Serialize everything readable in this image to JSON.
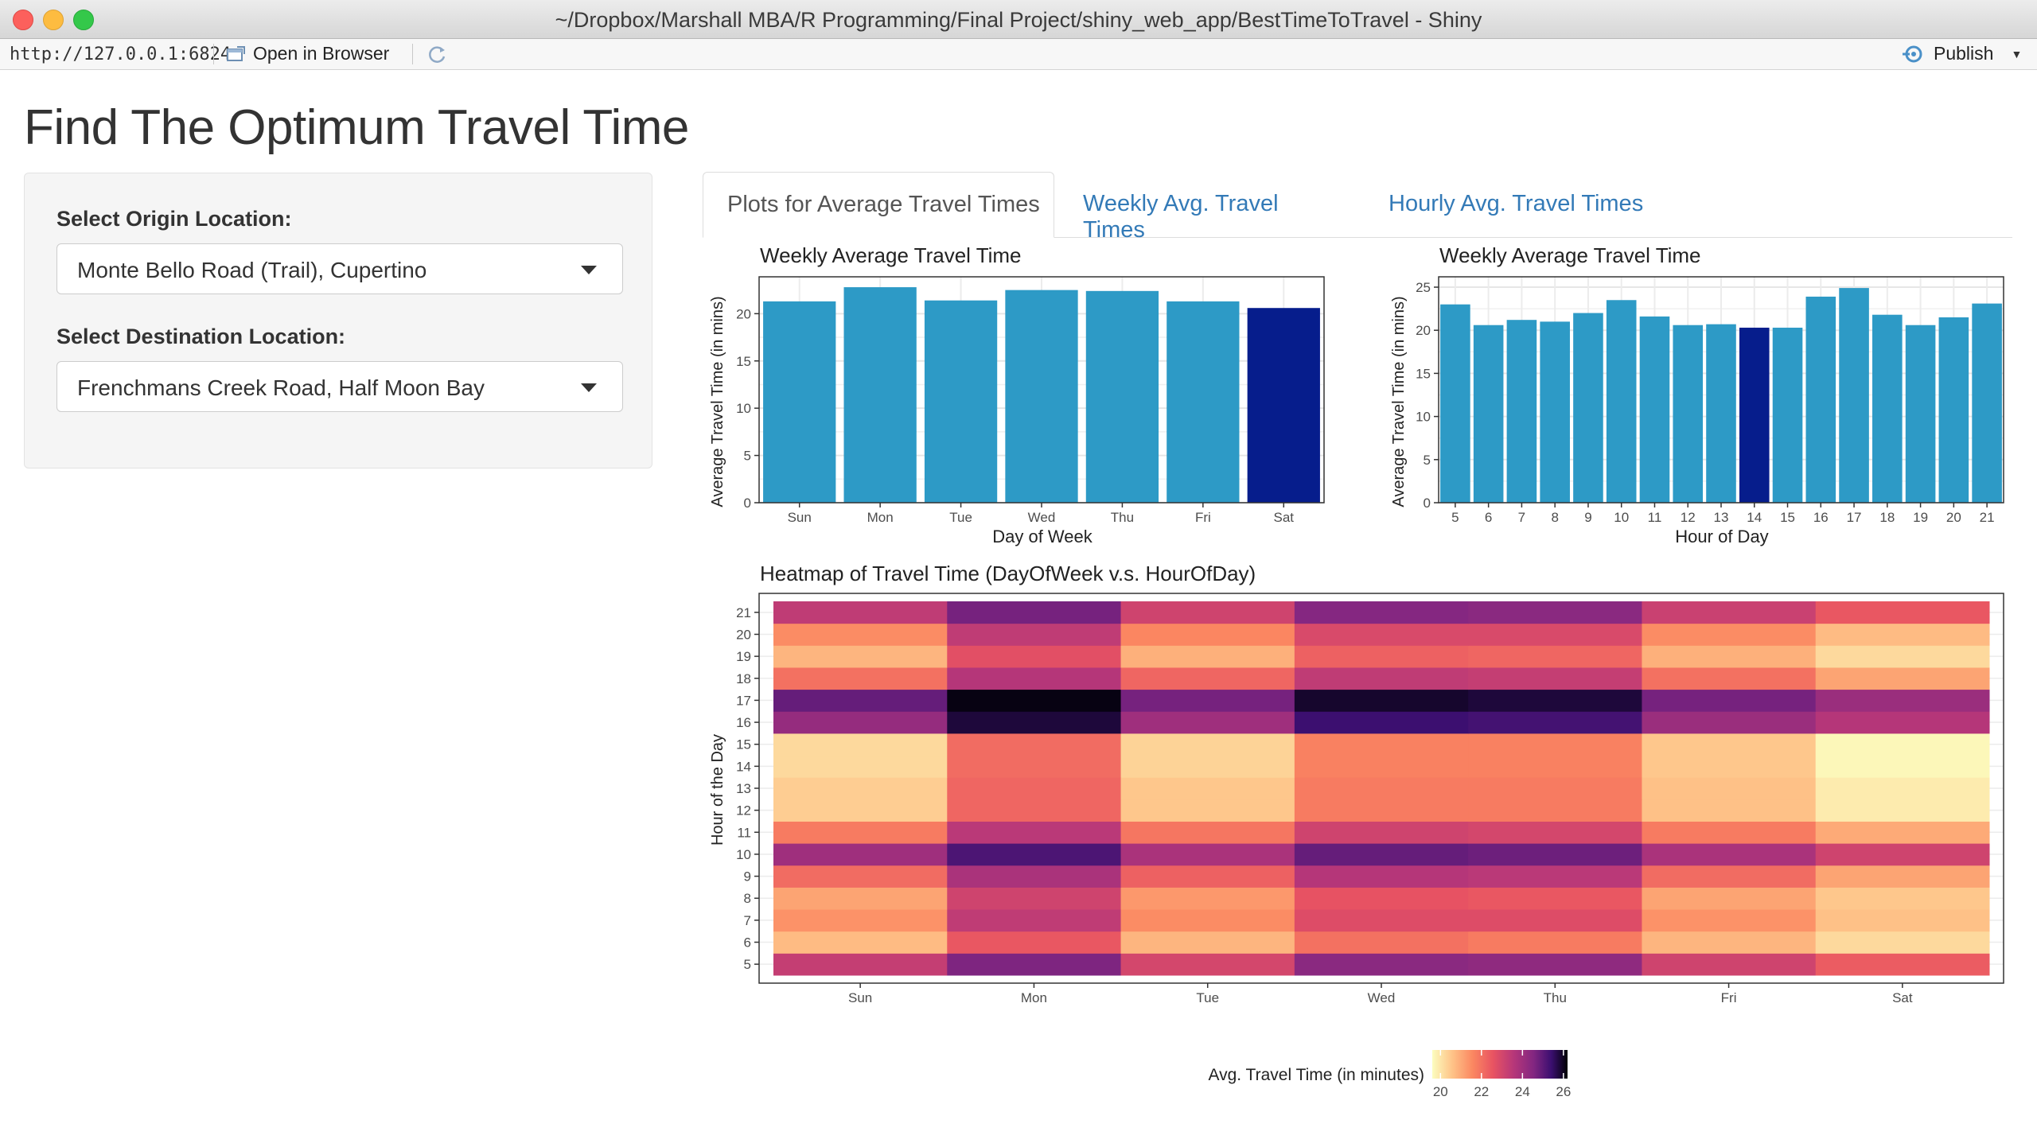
{
  "window": {
    "title": "~/Dropbox/Marshall MBA/R Programming/Final Project/shiny_web_app/BestTimeToTravel - Shiny"
  },
  "toolbar": {
    "url": "http://127.0.0.1:6824",
    "open_browser": "Open in Browser",
    "publish": "Publish"
  },
  "page": {
    "title": "Find The Optimum Travel Time"
  },
  "sidebar": {
    "origin_label": "Select Origin Location:",
    "origin_value": "Monte Bello Road (Trail), Cupertino",
    "destination_label": "Select Destination Location:",
    "destination_value": "Frenchmans Creek Road, Half Moon Bay"
  },
  "tabs": [
    {
      "label": "Plots for Average Travel Times",
      "active": true
    },
    {
      "label": "Weekly Avg. Travel Times",
      "active": false
    },
    {
      "label": "Hourly Avg. Travel Times",
      "active": false
    }
  ],
  "colors": {
    "bar": "#2d9ac6",
    "bar_min": "#061d8c",
    "link": "#337ab7"
  },
  "chart_data": [
    {
      "type": "bar",
      "title": "Weekly Average Travel Time",
      "xlabel": "Day of Week",
      "ylabel": "Average Travel Time (in mins)",
      "categories": [
        "Sun",
        "Mon",
        "Tue",
        "Wed",
        "Thu",
        "Fri",
        "Sat"
      ],
      "values": [
        21.3,
        22.8,
        21.4,
        22.5,
        22.4,
        21.3,
        20.6
      ],
      "highlight": "Sat",
      "ylim": [
        0,
        23.9
      ],
      "yticks": [
        0,
        5,
        10,
        15,
        20
      ]
    },
    {
      "type": "bar",
      "title": "Weekly Average Travel Time",
      "xlabel": "Hour of Day",
      "ylabel": "Average Travel Time (in mins)",
      "categories": [
        "5",
        "6",
        "7",
        "8",
        "9",
        "10",
        "11",
        "12",
        "13",
        "14",
        "15",
        "16",
        "17",
        "18",
        "19",
        "20",
        "21"
      ],
      "values": [
        23.0,
        20.6,
        21.2,
        21.0,
        22.0,
        23.5,
        21.6,
        20.6,
        20.7,
        20.3,
        20.3,
        23.9,
        24.9,
        21.8,
        20.6,
        21.5,
        23.1
      ],
      "highlight": "14",
      "ylim": [
        0,
        26.2
      ],
      "yticks": [
        0,
        5,
        10,
        15,
        20,
        25
      ]
    },
    {
      "type": "heatmap",
      "title": "Heatmap of Travel Time (DayOfWeek v.s. HourOfDay)",
      "xlabel": "",
      "ylabel": "Hour of the Day",
      "x": [
        "Sun",
        "Mon",
        "Tue",
        "Wed",
        "Thu",
        "Fri",
        "Sat"
      ],
      "y": [
        "5",
        "6",
        "7",
        "8",
        "9",
        "10",
        "11",
        "12",
        "13",
        "14",
        "15",
        "16",
        "17",
        "18",
        "19",
        "20",
        "21"
      ],
      "z": [
        [
          23.3,
          24.6,
          23.0,
          24.4,
          24.3,
          23.1,
          22.4
        ],
        [
          20.7,
          22.5,
          20.8,
          22.0,
          21.8,
          20.8,
          20.2
        ],
        [
          21.4,
          23.4,
          21.5,
          22.8,
          22.8,
          21.4,
          20.6
        ],
        [
          21.1,
          23.1,
          21.3,
          22.6,
          22.5,
          21.1,
          20.5
        ],
        [
          22.1,
          23.8,
          22.3,
          23.6,
          23.5,
          22.1,
          21.1
        ],
        [
          24.0,
          25.2,
          23.8,
          24.9,
          24.8,
          23.8,
          23.1
        ],
        [
          21.8,
          23.5,
          21.9,
          23.1,
          23.0,
          21.8,
          21.0
        ],
        [
          20.4,
          22.2,
          20.5,
          21.8,
          21.8,
          20.6,
          19.9
        ],
        [
          20.4,
          22.2,
          20.5,
          21.8,
          21.8,
          20.6,
          19.9
        ],
        [
          20.2,
          22.1,
          20.3,
          21.7,
          21.7,
          20.5,
          19.7
        ],
        [
          20.2,
          22.1,
          20.3,
          21.7,
          21.7,
          20.5,
          19.7
        ],
        [
          24.2,
          25.8,
          24.0,
          25.4,
          25.3,
          24.1,
          23.6
        ],
        [
          24.9,
          26.1,
          24.7,
          25.9,
          25.8,
          24.7,
          24.1
        ],
        [
          22.0,
          23.6,
          22.2,
          23.4,
          23.3,
          22.0,
          21.1
        ],
        [
          20.8,
          22.7,
          20.9,
          22.3,
          22.2,
          20.9,
          20.2
        ],
        [
          21.5,
          23.4,
          21.6,
          22.9,
          22.9,
          21.5,
          20.7
        ],
        [
          23.4,
          24.7,
          23.1,
          24.5,
          24.4,
          23.2,
          22.5
        ]
      ],
      "legend_title": "Avg. Travel Time (in minutes)",
      "legend_ticks": [
        20,
        22,
        24,
        26
      ],
      "zlim": [
        19.6,
        26.2
      ]
    }
  ]
}
